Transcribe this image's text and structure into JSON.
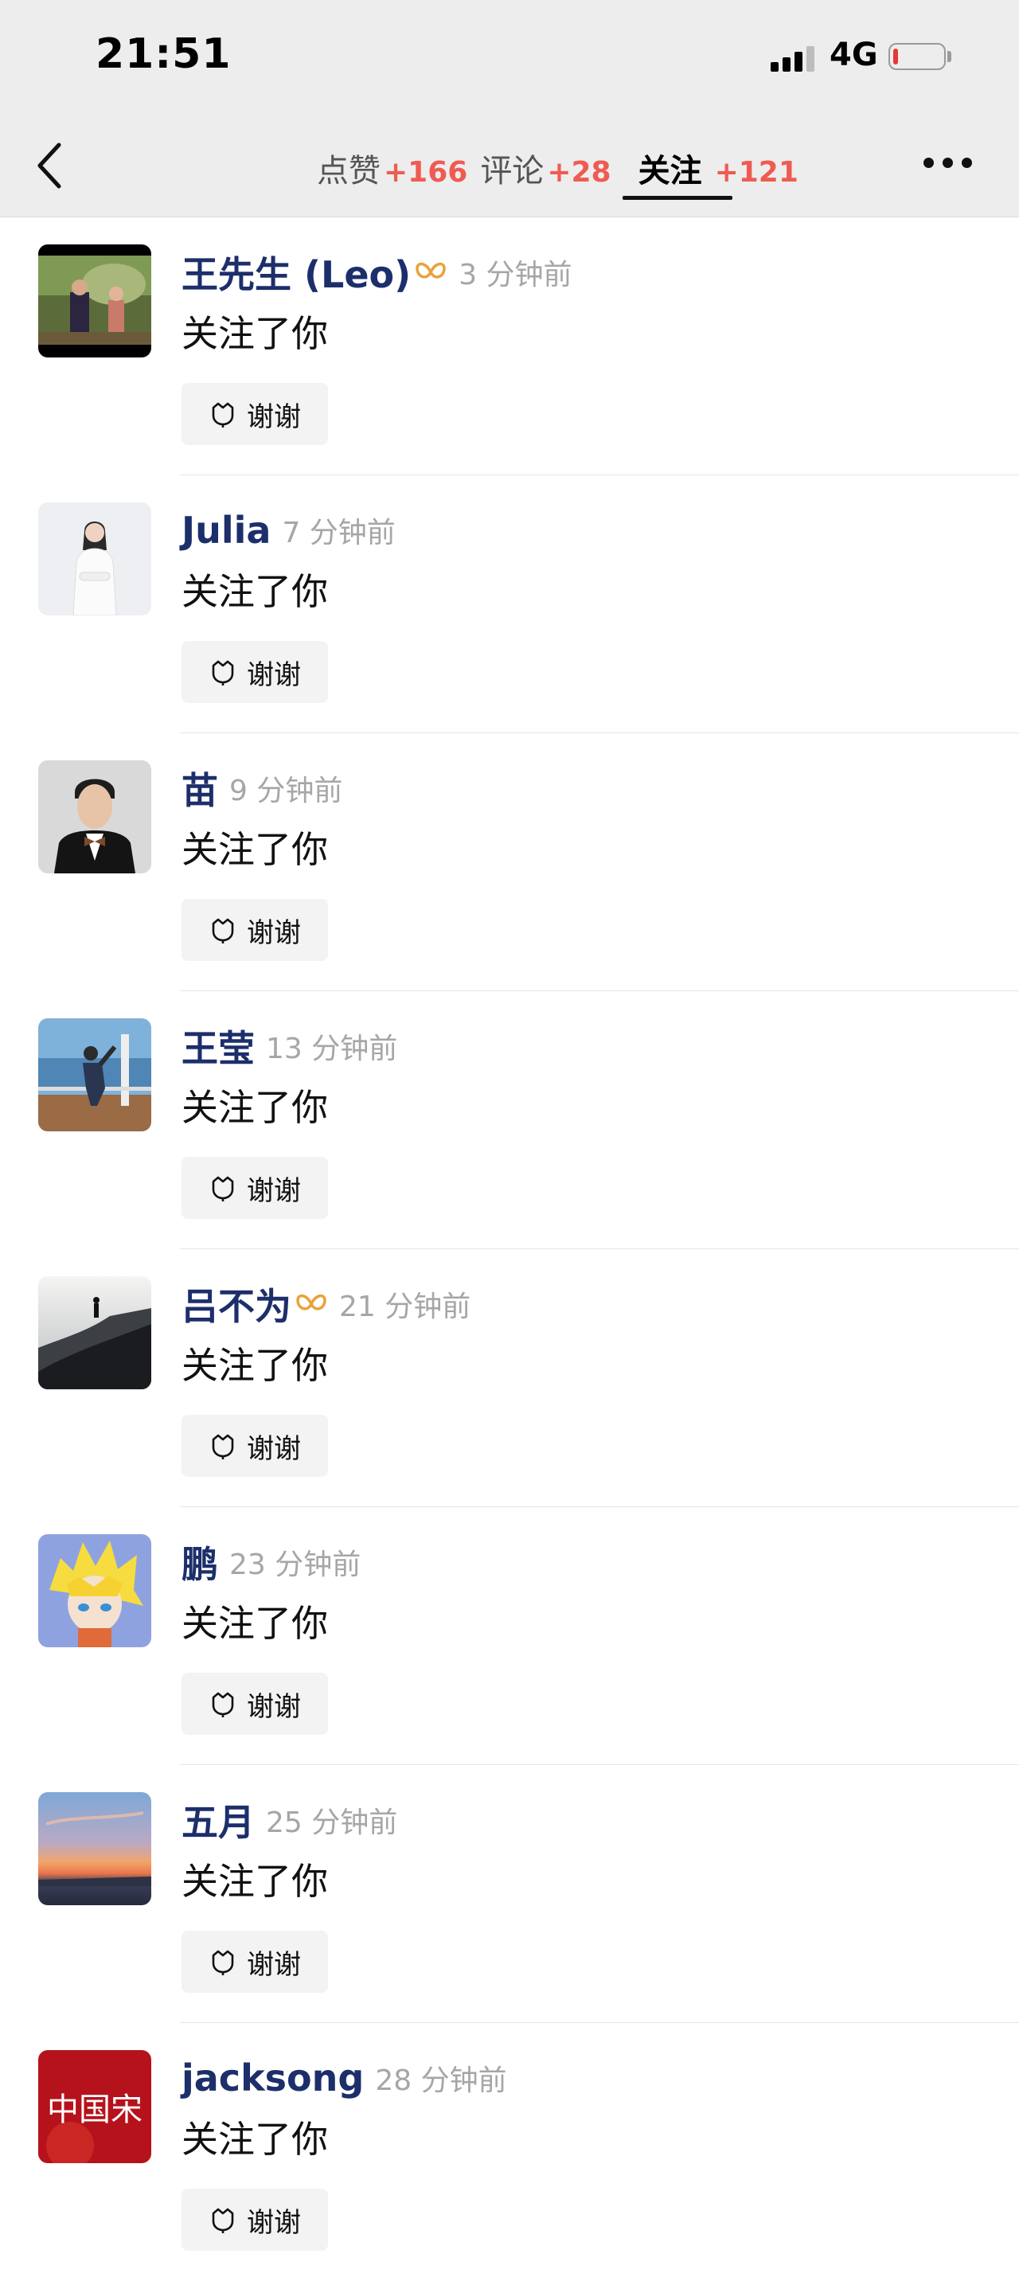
{
  "status_bar": {
    "time": "21:51",
    "network": "4G"
  },
  "nav": {
    "tabs": [
      {
        "label": "点赞",
        "count": "+166"
      },
      {
        "label": "评论",
        "count": "+28"
      },
      {
        "label": "关注",
        "count": "+121",
        "active": true
      }
    ]
  },
  "colors": {
    "name": "#1c2f6b",
    "count": "#ef5b52",
    "vip": "#e9a23b"
  },
  "items": [
    {
      "name": "王先生 (Leo)",
      "vip": true,
      "time": "3 分钟前",
      "action": "关注了你",
      "button": "谢谢"
    },
    {
      "name": "Julia",
      "vip": false,
      "time": "7 分钟前",
      "action": "关注了你",
      "button": "谢谢"
    },
    {
      "name": "苗",
      "vip": false,
      "time": "9 分钟前",
      "action": "关注了你",
      "button": "谢谢"
    },
    {
      "name": "王莹",
      "vip": false,
      "time": "13 分钟前",
      "action": "关注了你",
      "button": "谢谢"
    },
    {
      "name": "吕不为",
      "vip": true,
      "time": "21 分钟前",
      "action": "关注了你",
      "button": "谢谢"
    },
    {
      "name": "鹏",
      "vip": false,
      "time": "23 分钟前",
      "action": "关注了你",
      "button": "谢谢"
    },
    {
      "name": "五月",
      "vip": false,
      "time": "25 分钟前",
      "action": "关注了你",
      "button": "谢谢"
    },
    {
      "name": "jacksong",
      "vip": false,
      "time": "28 分钟前",
      "action": "关注了你",
      "button": "谢谢"
    }
  ],
  "avatars": [
    {
      "icon": "movie-couple-avatar"
    },
    {
      "icon": "woman-white-suit-avatar"
    },
    {
      "icon": "man-bowtie-avatar"
    },
    {
      "icon": "man-on-deck-avatar"
    },
    {
      "icon": "hiker-silhouette-avatar"
    },
    {
      "icon": "anime-boy-avatar"
    },
    {
      "icon": "sunset-avatar"
    },
    {
      "icon": "red-calligraphy-avatar",
      "text": "中国宋"
    }
  ]
}
